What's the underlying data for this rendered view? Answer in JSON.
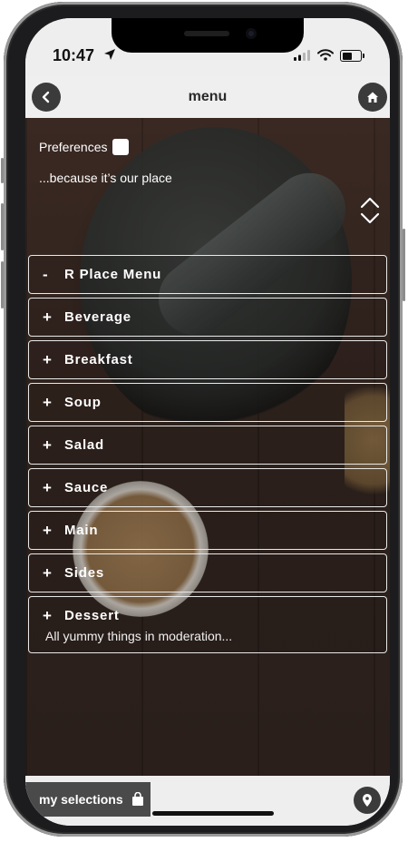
{
  "status": {
    "time": "10:47"
  },
  "header": {
    "title": "menu",
    "back_icon": "chevron-left-icon",
    "home_icon": "home-icon"
  },
  "intro": {
    "preferences_label": "Preferences",
    "tagline": "...because it’s our place"
  },
  "menu": [
    {
      "sign": "-",
      "label": "R Place Menu",
      "expanded": true
    },
    {
      "sign": "+",
      "label": "Beverage"
    },
    {
      "sign": "+",
      "label": "Breakfast"
    },
    {
      "sign": "+",
      "label": "Soup"
    },
    {
      "sign": "+",
      "label": "Salad"
    },
    {
      "sign": "+",
      "label": "Sauce"
    },
    {
      "sign": "+",
      "label": "Main"
    },
    {
      "sign": "+",
      "label": "Sides"
    },
    {
      "sign": "+",
      "label": "Dessert",
      "sub": "All yummy things in moderation..."
    }
  ],
  "footer": {
    "selections_label": "my selections",
    "bag_icon": "shopping-bag-icon",
    "location_icon": "map-pin-icon"
  },
  "colors": {
    "bar": "#eeeeee",
    "button": "#3b3b3b",
    "text_light": "#ffffff"
  }
}
